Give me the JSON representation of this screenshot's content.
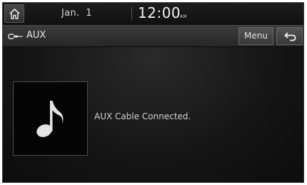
{
  "status_bar": {
    "date": "Jan.  1",
    "time": "12:00",
    "ampm": "AM",
    "home_icon": "home-icon"
  },
  "title_bar": {
    "source_icon": "aux-cable-icon",
    "source_title": "AUX",
    "menu_label": "Menu",
    "back_icon": "back-arrow-icon"
  },
  "main": {
    "album_art_icon": "music-note-icon",
    "status_message": "AUX Cable Connected."
  },
  "colors": {
    "background": "#161616",
    "text": "#d0d0d0",
    "button_face": "#454545"
  }
}
